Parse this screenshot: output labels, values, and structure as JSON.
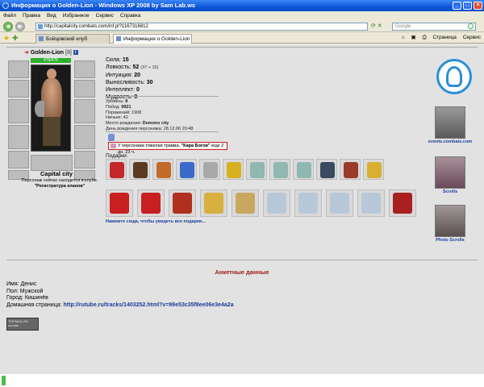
{
  "window": {
    "title": "Информация о Golden-Lion - Windows XP 2008 by Sam Lab.ws",
    "controls": [
      "_",
      "□",
      "×"
    ]
  },
  "menu": [
    "Файл",
    "Правка",
    "Вид",
    "Избранное",
    "Сервис",
    "Справка"
  ],
  "address": {
    "url": "http://capitalcity.combats.com/inf.pl?1167316812",
    "search_placeholder": "Google"
  },
  "tabs": [
    {
      "label": "Бойцовский клуб",
      "active": false
    },
    {
      "label": "Информация о Golden-Lion",
      "active": true
    }
  ],
  "toolbar": {
    "page_label": "Страница",
    "tools_label": "Сервис"
  },
  "character": {
    "name": "Golden-Lion",
    "level": "[8]",
    "hp": "476/476",
    "city": "Capital city",
    "location_note": "Персонаж сейчас находится в клубе.",
    "location_room": "\"Регистратура кланов\""
  },
  "stats": {
    "strength_label": "Сила:",
    "strength": "15",
    "agility_label": "Ловкость:",
    "agility": "52",
    "agility_extra": "(37 + 15)",
    "intuition_label": "Интуиция:",
    "intuition": "20",
    "endurance_label": "Выносливость:",
    "endurance": "30",
    "intellect_label": "Интеллект:",
    "intellect": "0",
    "wisdom_label": "Мудрость:",
    "wisdom": "0"
  },
  "record": {
    "level_label": "Уровень:",
    "level": "8",
    "wins_label": "Побед:",
    "wins": "9921",
    "losses_label": "Поражений:",
    "losses": "1908",
    "draws_label": "Ничьих:",
    "draws": "42",
    "birthplace_label": "Место рождения:",
    "birthplace": "Demons city",
    "birthday_label": "День рождения персонажа:",
    "birthday": "28.12.06 20:48"
  },
  "trauma": {
    "prefix": "У персонажа тяжелая травма.",
    "name": "\"Кара Богов\"",
    "suffix": "еще 2 дн. 23 ч."
  },
  "gifts": {
    "label": "Подарки:",
    "link": "Нажмите сюда, чтобы увидеть все подарки...",
    "row1_colors": [
      "#c4282a",
      "#5a3a20",
      "#c26a2a",
      "#3a6ac9",
      "#a8a8a8",
      "#d8b020",
      "#8fb8b0",
      "#8fb8b0",
      "#8fb8b0",
      "#3a4a60",
      "#9a3a2a",
      "#d8b030"
    ],
    "row2_colors": [
      "#c82020",
      "#c82020",
      "#b03020",
      "#d8b040",
      "#c8a860",
      "#b8c8d8",
      "#b8c8d8",
      "#b8c8d8",
      "#b8c8d8",
      "#a82020"
    ]
  },
  "side": {
    "site_label": "events.combats.com",
    "scrolls_label": "Scrolls",
    "photo_label": "Photo Scrolls"
  },
  "profile": {
    "title": "Анкетные данные",
    "name_label": "Имя:",
    "name": "Денис",
    "sex_label": "Пол:",
    "sex": "Мужской",
    "city_label": "Город:",
    "city": "Кишинёв",
    "home_label": "Домашняя страница:",
    "home_url": "http://rutube.ru/tracks/1403252.html?v=99e53c35f8ee06e3e4a2a"
  },
  "counter_text": "TOP.MAIL.RU counter"
}
